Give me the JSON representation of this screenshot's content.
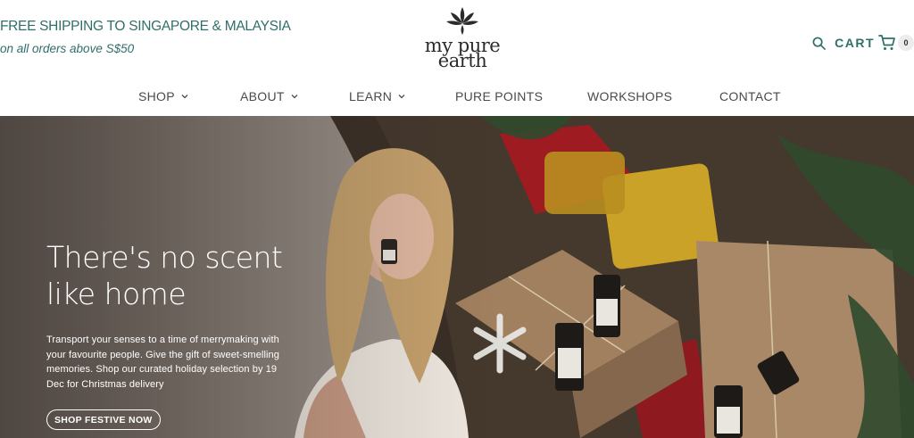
{
  "promo": {
    "title": "FREE SHIPPING TO SINGAPORE & MALAYSIA",
    "subtitle": "on all orders above S$50",
    "color": "#2f6f6a"
  },
  "logo": {
    "line1": "my pure",
    "line2": "earth"
  },
  "header_actions": {
    "search_icon": "search-icon",
    "cart_label": "CART",
    "cart_icon": "cart-icon",
    "cart_count": "0"
  },
  "nav": {
    "items": [
      {
        "label": "SHOP",
        "has_dropdown": true
      },
      {
        "label": "ABOUT",
        "has_dropdown": true
      },
      {
        "label": "LEARN",
        "has_dropdown": true
      },
      {
        "label": "PURE POINTS",
        "has_dropdown": false
      },
      {
        "label": "WORKSHOPS",
        "has_dropdown": false
      },
      {
        "label": "CONTACT",
        "has_dropdown": false
      }
    ]
  },
  "hero": {
    "heading": "There's no scent like home",
    "body": "Transport your senses to a time of merrymaking with your favourite people. Give the gift of sweet-smelling memories. Shop our curated holiday selection by 19 Dec for Christmas delivery",
    "cta_label": "SHOP FESTIVE NOW"
  }
}
